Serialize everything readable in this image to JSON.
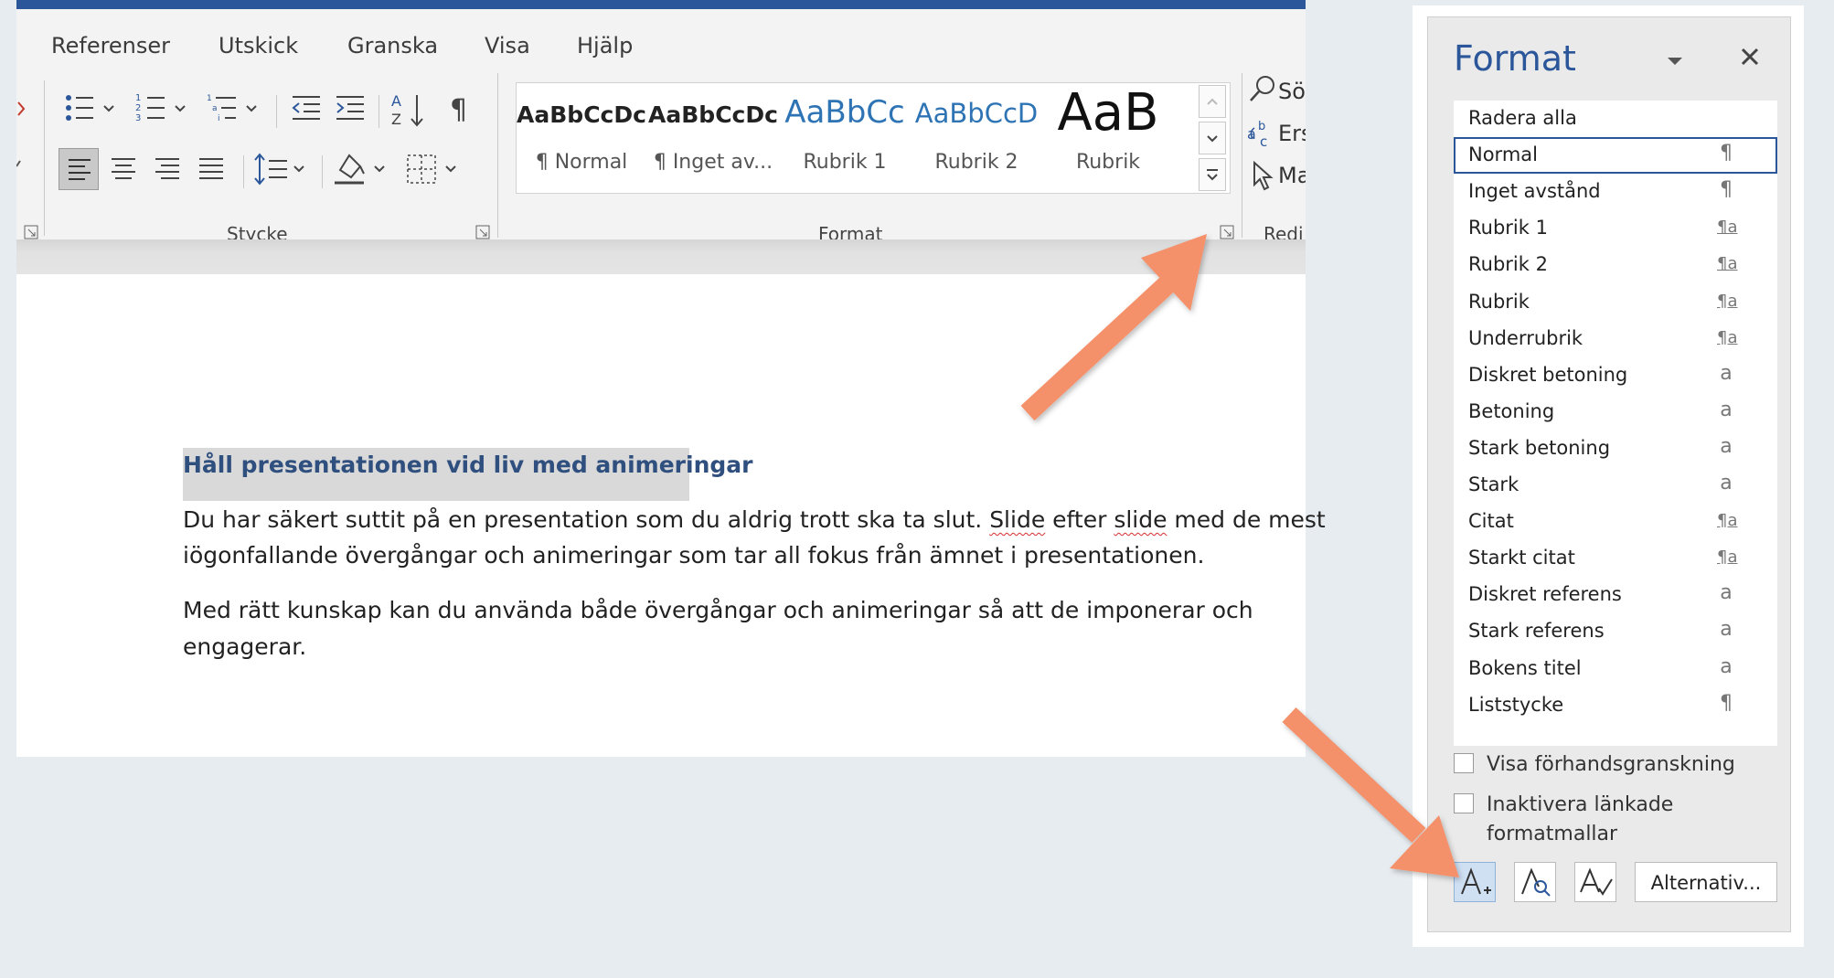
{
  "ribbon": {
    "tabs": [
      "Referenser",
      "Utskick",
      "Granska",
      "Visa",
      "Hjälp"
    ],
    "groups": {
      "paragraph": "Stycke",
      "styles": "Format",
      "editing": "Redi"
    },
    "editing_items": [
      "Sö",
      "Ers",
      "Ma"
    ],
    "gallery": [
      {
        "sample": "AaBbCcDc",
        "name": "¶ Normal"
      },
      {
        "sample": "AaBbCcDc",
        "name": "¶ Inget av..."
      },
      {
        "sample": "AaBbCc",
        "name": "Rubrik 1"
      },
      {
        "sample": "AaBbCcD",
        "name": "Rubrik 2"
      },
      {
        "sample": "AaB",
        "name": "Rubrik"
      }
    ]
  },
  "document": {
    "heading": "Håll presentationen vid liv med animeringar",
    "para1_line1_a": "Du har säkert suttit på en presentation som du aldrig trott ska ta slut. ",
    "para1_line1_b": "Slide",
    "para1_line1_c": " efter ",
    "para1_line1_d": "slide",
    "para1_line1_e": " med de mest",
    "para1_line2": "iögonfallande övergångar och animeringar som tar all fokus från ämnet i presentationen.",
    "para2_line1": "Med rätt kunskap kan du använda både övergångar och animeringar så att de imponerar och",
    "para2_line2": "engagerar."
  },
  "pane": {
    "title": "Format",
    "styles": [
      {
        "name": "Radera alla",
        "type": ""
      },
      {
        "name": "Normal",
        "type": "¶"
      },
      {
        "name": "Inget avstånd",
        "type": "¶"
      },
      {
        "name": "Rubrik 1",
        "type": "¶a"
      },
      {
        "name": "Rubrik 2",
        "type": "¶a"
      },
      {
        "name": "Rubrik",
        "type": "¶a"
      },
      {
        "name": "Underrubrik",
        "type": "¶a"
      },
      {
        "name": "Diskret betoning",
        "type": "a"
      },
      {
        "name": "Betoning",
        "type": "a"
      },
      {
        "name": "Stark betoning",
        "type": "a"
      },
      {
        "name": "Stark",
        "type": "a"
      },
      {
        "name": "Citat",
        "type": "¶a"
      },
      {
        "name": "Starkt citat",
        "type": "¶a"
      },
      {
        "name": "Diskret referens",
        "type": "a"
      },
      {
        "name": "Stark referens",
        "type": "a"
      },
      {
        "name": "Bokens titel",
        "type": "a"
      },
      {
        "name": "Liststycke",
        "type": "¶"
      }
    ],
    "selected_style": "Normal",
    "checkbox_preview": "Visa förhandsgranskning",
    "checkbox_linked_line1": "Inaktivera länkade",
    "checkbox_linked_line2": "formatmallar",
    "options_button": "Alternativ..."
  },
  "colors": {
    "accent": "#2b579a",
    "arrow": "#f4906a"
  }
}
